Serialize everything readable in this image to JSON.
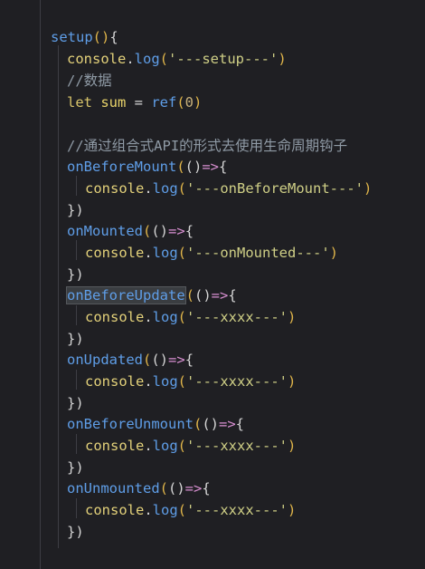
{
  "editor": {
    "lines": [
      {
        "tokens": [
          [
            "fn",
            "setup"
          ],
          [
            "paren",
            "()"
          ],
          [
            "punc",
            "{"
          ]
        ]
      },
      {
        "tokens": [
          [
            "obj",
            "console"
          ],
          [
            "punc",
            "."
          ],
          [
            "fn",
            "log"
          ],
          [
            "paren",
            "("
          ],
          [
            "str",
            "'---setup---'"
          ],
          [
            "paren",
            ")"
          ]
        ]
      },
      {
        "tokens": [
          [
            "comment",
            "//数据"
          ]
        ]
      },
      {
        "tokens": [
          [
            "kw",
            "let "
          ],
          [
            "id",
            "sum "
          ],
          [
            "op",
            "= "
          ],
          [
            "fn",
            "ref"
          ],
          [
            "paren",
            "("
          ],
          [
            "num",
            "0"
          ],
          [
            "paren",
            ")"
          ]
        ]
      },
      {
        "tokens": []
      },
      {
        "tokens": [
          [
            "comment",
            "//通过组合式API的形式去使用生命周期钩子"
          ]
        ]
      },
      {
        "tokens": [
          [
            "fn",
            "onBeforeMount"
          ],
          [
            "paren",
            "("
          ],
          [
            "arrowparen",
            "()"
          ],
          [
            "arrow",
            "=>"
          ],
          [
            "punc",
            "{"
          ]
        ]
      },
      {
        "tokens": [
          [
            "obj",
            "console"
          ],
          [
            "punc",
            "."
          ],
          [
            "fn",
            "log"
          ],
          [
            "paren",
            "("
          ],
          [
            "str",
            "'---onBeforeMount---'"
          ],
          [
            "paren",
            ")"
          ]
        ]
      },
      {
        "tokens": [
          [
            "punc",
            "})"
          ]
        ]
      },
      {
        "tokens": [
          [
            "fn",
            "onMounted"
          ],
          [
            "paren",
            "("
          ],
          [
            "arrowparen",
            "()"
          ],
          [
            "arrow",
            "=>"
          ],
          [
            "punc",
            "{"
          ]
        ]
      },
      {
        "tokens": [
          [
            "obj",
            "console"
          ],
          [
            "punc",
            "."
          ],
          [
            "fn",
            "log"
          ],
          [
            "paren",
            "("
          ],
          [
            "str",
            "'---onMounted---'"
          ],
          [
            "paren",
            ")"
          ]
        ]
      },
      {
        "tokens": [
          [
            "punc",
            "})"
          ]
        ]
      },
      {
        "tokens": [
          [
            "fnsel",
            "onBeforeUpdate"
          ],
          [
            "cursor",
            ""
          ],
          [
            "paren",
            "("
          ],
          [
            "arrowparen",
            "()"
          ],
          [
            "arrow",
            "=>"
          ],
          [
            "punc",
            "{"
          ]
        ]
      },
      {
        "tokens": [
          [
            "obj",
            "console"
          ],
          [
            "punc",
            "."
          ],
          [
            "fn",
            "log"
          ],
          [
            "paren",
            "("
          ],
          [
            "str",
            "'---xxxx---'"
          ],
          [
            "paren",
            ")"
          ]
        ]
      },
      {
        "tokens": [
          [
            "punc",
            "})"
          ]
        ]
      },
      {
        "tokens": [
          [
            "fn",
            "onUpdated"
          ],
          [
            "paren",
            "("
          ],
          [
            "arrowparen",
            "()"
          ],
          [
            "arrow",
            "=>"
          ],
          [
            "punc",
            "{"
          ]
        ]
      },
      {
        "tokens": [
          [
            "obj",
            "console"
          ],
          [
            "punc",
            "."
          ],
          [
            "fn",
            "log"
          ],
          [
            "paren",
            "("
          ],
          [
            "str",
            "'---xxxx---'"
          ],
          [
            "paren",
            ")"
          ]
        ]
      },
      {
        "tokens": [
          [
            "punc",
            "})"
          ]
        ]
      },
      {
        "tokens": [
          [
            "fn",
            "onBeforeUnmount"
          ],
          [
            "paren",
            "("
          ],
          [
            "arrowparen",
            "()"
          ],
          [
            "arrow",
            "=>"
          ],
          [
            "punc",
            "{"
          ]
        ]
      },
      {
        "tokens": [
          [
            "obj",
            "console"
          ],
          [
            "punc",
            "."
          ],
          [
            "fn",
            "log"
          ],
          [
            "paren",
            "("
          ],
          [
            "str",
            "'---xxxx---'"
          ],
          [
            "paren",
            ")"
          ]
        ]
      },
      {
        "tokens": [
          [
            "punc",
            "})"
          ]
        ]
      },
      {
        "tokens": [
          [
            "fn",
            "onUnmounted"
          ],
          [
            "paren",
            "("
          ],
          [
            "arrowparen",
            "()"
          ],
          [
            "arrow",
            "=>"
          ],
          [
            "punc",
            "{"
          ]
        ]
      },
      {
        "tokens": [
          [
            "obj",
            "console"
          ],
          [
            "punc",
            "."
          ],
          [
            "fn",
            "log"
          ],
          [
            "paren",
            "("
          ],
          [
            "str",
            "'---xxxx---'"
          ],
          [
            "paren",
            ")"
          ]
        ]
      },
      {
        "tokens": [
          [
            "punc",
            "})"
          ]
        ]
      }
    ]
  },
  "colors": {
    "background": "#1f1f23",
    "function": "#5f9ee8",
    "string": "#cfcf86",
    "keyword": "#d7c36a",
    "comment": "#8f9aa5",
    "arrow": "#d78fd0"
  }
}
